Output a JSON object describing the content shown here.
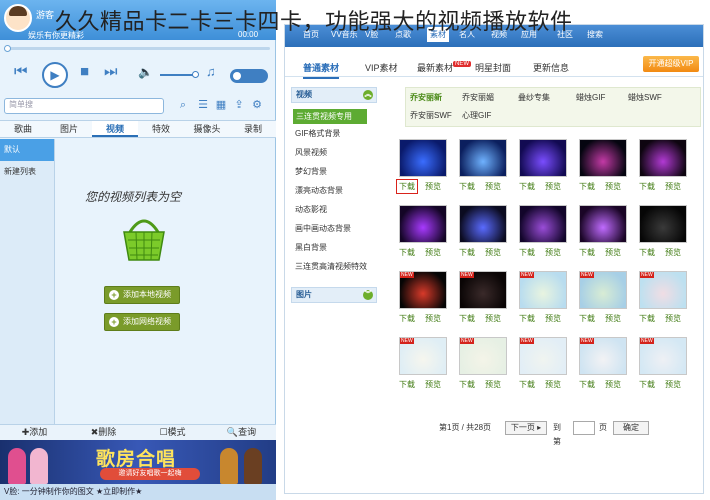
{
  "caption": "久久精品卡二卡三卡四卡，功能强大的视频播放软件",
  "player": {
    "user_name": "游客",
    "slogan": "娱乐有你更精彩",
    "time_display": "00:00",
    "toggle_label": "",
    "search_placeholder": "简单搜",
    "tabs": [
      {
        "label": "歌曲"
      },
      {
        "label": "图片"
      },
      {
        "label": "视频"
      },
      {
        "label": "特效"
      },
      {
        "label": "摄像头"
      },
      {
        "label": "录制"
      }
    ],
    "lists": [
      {
        "label": "默认"
      },
      {
        "label": "新建列表"
      }
    ],
    "empty_text": "您的视频列表为空",
    "add_local_btn": "添加本地视频",
    "add_net_btn": "添加网络视频",
    "bottom": [
      {
        "label": "✚添加"
      },
      {
        "label": "✖删除"
      },
      {
        "label": "☐模式"
      },
      {
        "label": "🔍查询"
      }
    ],
    "banner_title": "歌房合唱",
    "banner_sub": "邀请好友唱歌一起嗨",
    "marquee": "V脸: 一分钟制作你的图文 ★立即制作★"
  },
  "site": {
    "nav": [
      {
        "label": "首页"
      },
      {
        "label": "VV音乐"
      },
      {
        "label": "V脸"
      },
      {
        "label": "点歌"
      },
      {
        "label": "素材"
      },
      {
        "label": "名人"
      },
      {
        "label": "视频"
      },
      {
        "label": "应用"
      },
      {
        "label": "社区"
      },
      {
        "label": "搜索"
      }
    ],
    "nav_active_index": 4,
    "subtabs": [
      {
        "label": "普通素材"
      },
      {
        "label": "VIP素材"
      },
      {
        "label": "最新素材"
      },
      {
        "label": "明星封面"
      },
      {
        "label": "更新信息"
      }
    ],
    "new_badge": "NEW",
    "vip_button": "开通超级VIP",
    "video_section": "视频",
    "video_items": [
      {
        "label": "三连贯视频专用"
      },
      {
        "label": "GIF格式背景"
      },
      {
        "label": "风景视频"
      },
      {
        "label": "梦幻背景"
      },
      {
        "label": "漂亮动态背景"
      },
      {
        "label": "动态影视"
      },
      {
        "label": "画中画动态背景"
      },
      {
        "label": "黑白背景"
      },
      {
        "label": "三连贯高清视频特效"
      }
    ],
    "pic_section": "图片",
    "chips": [
      {
        "label": "乔安丽新"
      },
      {
        "label": "乔安丽媚"
      },
      {
        "label": "叠纱专集"
      },
      {
        "label": "蜡烛GIF"
      },
      {
        "label": "蜡烛SWF"
      },
      {
        "label": "乔安丽SWF"
      },
      {
        "label": "心理GIF"
      }
    ],
    "dl_label": "下载",
    "pv_label": "预览",
    "thumbs": [
      {
        "c1": "#0a1a6b",
        "c2": "#3a6dff",
        "new": false
      },
      {
        "c1": "#0b1f5e",
        "c2": "#6fb2ff",
        "new": false
      },
      {
        "c1": "#120a52",
        "c2": "#7a4dff",
        "new": false
      },
      {
        "c1": "#050510",
        "c2": "#c33aa6",
        "new": false
      },
      {
        "c1": "#0e0510",
        "c2": "#b23ad4",
        "new": false
      },
      {
        "c1": "#140526",
        "c2": "#a83aff",
        "new": false
      },
      {
        "c1": "#0b0b20",
        "c2": "#5a6bff",
        "new": false
      },
      {
        "c1": "#12052a",
        "c2": "#9a4dd8",
        "new": false
      },
      {
        "c1": "#1a0526",
        "c2": "#c06bff",
        "new": false
      },
      {
        "c1": "#060606",
        "c2": "#3a3a3a",
        "new": false
      },
      {
        "c1": "#050505",
        "c2": "#d83a2a",
        "new": true
      },
      {
        "c1": "#0a0505",
        "c2": "#3a2a2a",
        "new": true
      },
      {
        "c1": "#b8dcef",
        "c2": "#e8f4e0",
        "new": true
      },
      {
        "c1": "#a7cfe6",
        "c2": "#d8ecd4",
        "new": true
      },
      {
        "c1": "#bde0f0",
        "c2": "#f0dde4",
        "new": true
      },
      {
        "c1": "#dfeef5",
        "c2": "#f6f6ee",
        "new": true
      },
      {
        "c1": "#e6f0e4",
        "c2": "#f4f4e8",
        "new": true
      },
      {
        "c1": "#e2eef6",
        "c2": "#f0f4f0",
        "new": true
      },
      {
        "c1": "#cfe4f2",
        "c2": "#f2f2f4",
        "new": true
      },
      {
        "c1": "#d4e8f4",
        "c2": "#eef0f4",
        "new": true
      }
    ],
    "highlight_index": 0,
    "pager": {
      "info": "第1页 / 共28页",
      "next": "下一页 ▸",
      "goto": "到第",
      "page_unit": "页",
      "confirm": "确定"
    }
  }
}
